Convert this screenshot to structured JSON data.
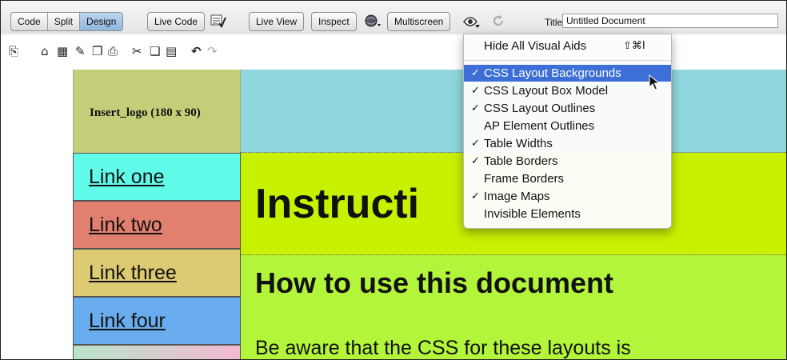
{
  "toolbar": {
    "view_modes": [
      "Code",
      "Split",
      "Design"
    ],
    "active_view": "Design",
    "live_code": "Live Code",
    "live_view": "Live View",
    "inspect": "Inspect",
    "multiscreen": "Multiscreen",
    "title_label": "Title:",
    "title_value": "Untitled Document"
  },
  "icons_row2": [
    "new-document-icon",
    "open-icon",
    "templates-icon",
    "edit-icon",
    "new-window-icon",
    "print-icon",
    "cut-icon",
    "copy-icon",
    "paste-icon",
    "undo-icon",
    "redo-icon"
  ],
  "document": {
    "logo_placeholder": "Insert_logo (180 x 90)",
    "nav_links": [
      "Link one",
      "Link two",
      "Link three",
      "Link four"
    ],
    "heading1": "Instructi",
    "heading2": "How to use this document",
    "paragraph": "Be aware that the CSS for these layouts is"
  },
  "visual_aids_menu": {
    "items": [
      {
        "label": "Hide All Visual Aids",
        "checked": false,
        "shortcut": "⇧⌘I"
      },
      {
        "label": "CSS Layout Backgrounds",
        "checked": true,
        "selected": true
      },
      {
        "label": "CSS Layout Box Model",
        "checked": true
      },
      {
        "label": "CSS Layout Outlines",
        "checked": true
      },
      {
        "label": "AP Element Outlines",
        "checked": false
      },
      {
        "label": "Table Widths",
        "checked": true
      },
      {
        "label": "Table Borders",
        "checked": true
      },
      {
        "label": "Frame Borders",
        "checked": false
      },
      {
        "label": "Image Maps",
        "checked": true
      },
      {
        "label": "Invisible Elements",
        "checked": false
      }
    ],
    "checkmark": "✓"
  },
  "colors": {
    "logo_bg": "#c4ce79",
    "header_bg": "#8fd7dd",
    "link_one_bg": "#61fbe9",
    "link_two_bg": "#e2806f",
    "link_three_bg": "#dccb72",
    "link_four_bg": "#6aadee",
    "instructions_bg": "#c8f100",
    "howto_bg": "#b3f53a",
    "menu_highlight": "#3d6fd6"
  }
}
